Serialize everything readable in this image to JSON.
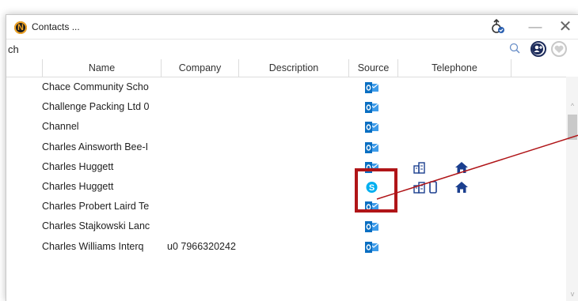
{
  "window": {
    "title": "Contacts ...",
    "minimize_glyph": "—",
    "close_glyph": "✕"
  },
  "search": {
    "value": "ch"
  },
  "columns": [
    "Name",
    "Company",
    "Description",
    "Source",
    "Telephone"
  ],
  "rows": [
    {
      "name": "Chace Community Scho",
      "description": "",
      "source": "outlook",
      "telephone": []
    },
    {
      "name": "Challenge Packing Ltd 0",
      "description": "",
      "source": "outlook",
      "telephone": []
    },
    {
      "name": "Channel",
      "description": "",
      "source": "outlook",
      "telephone": []
    },
    {
      "name": "Charles Ainsworth Bee-I",
      "description": "",
      "source": "outlook",
      "telephone": []
    },
    {
      "name": "Charles Huggett",
      "description": "",
      "source": "outlook",
      "telephone": [
        "office",
        "home"
      ]
    },
    {
      "name": "Charles Huggett",
      "description": "",
      "source": "skype",
      "telephone": [
        "office",
        "mobile",
        "home"
      ]
    },
    {
      "name": "Charles Probert Laird Te",
      "description": "",
      "source": "outlook",
      "telephone": []
    },
    {
      "name": "Charles Stajkowski Lanc",
      "description": "",
      "source": "outlook",
      "telephone": []
    },
    {
      "name": "Charles Williams Interq",
      "description": "u0 7966320242",
      "source": "outlook",
      "telephone": []
    }
  ],
  "colors": {
    "outlook": "#0a6fc2",
    "skype": "#00aff0",
    "telephone_icons": "#1b3f8f",
    "highlight": "#b01518"
  },
  "icons": {
    "app": "app-logo-icon",
    "upload": "upload-check-icon",
    "minimize": "minimize-icon",
    "close": "close-icon",
    "search": "search-icon",
    "add_contact": "add-contact-icon",
    "favorite": "heart-icon"
  }
}
